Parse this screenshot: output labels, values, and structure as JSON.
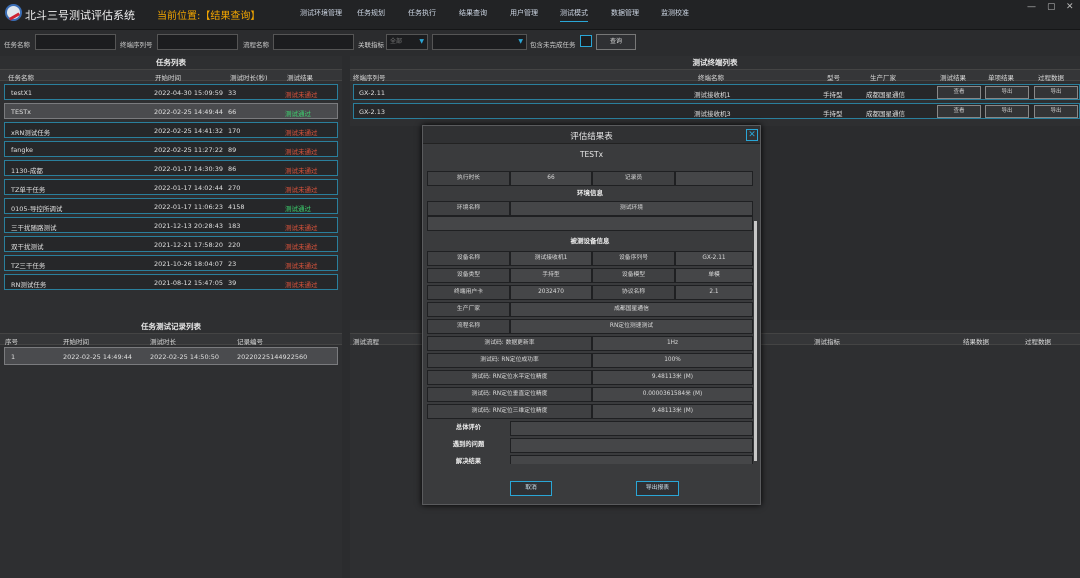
{
  "app": {
    "title": "北斗三号测试评估系统",
    "location": "当前位置:【结果查询】"
  },
  "nav": [
    {
      "label": "测试环境管理"
    },
    {
      "label": "任务规划"
    },
    {
      "label": "任务执行"
    },
    {
      "label": "结果查询"
    },
    {
      "label": "用户管理"
    },
    {
      "label": "测试模式"
    },
    {
      "label": "数据管理"
    },
    {
      "label": "监测校准"
    }
  ],
  "window": {
    "minimize": "—",
    "restore": "▢",
    "close": "✕"
  },
  "filters": {
    "task_name_label": "任务名称",
    "terminal_serial_label": "终端序列号",
    "process_name_label": "流程名称",
    "indicator_label": "关联指标",
    "indicator_value": "全部",
    "include_incomplete_label": "包含未完成任务",
    "query_button": "查询"
  },
  "task_list": {
    "title": "任务列表",
    "columns": [
      "任务名称",
      "开始时间",
      "测试时长(秒)",
      "测试结果"
    ],
    "rows": [
      {
        "name": "testX1",
        "start": "2022-04-30 15:09:59",
        "duration": "33",
        "result": "测试未通过",
        "status": "fail"
      },
      {
        "name": "TESTx",
        "start": "2022-02-25 14:49:44",
        "duration": "66",
        "result": "测试通过",
        "status": "pass"
      },
      {
        "name": "xRN测试任务",
        "start": "2022-02-25 14:41:32",
        "duration": "170",
        "result": "测试未通过",
        "status": "fail"
      },
      {
        "name": "fangke",
        "start": "2022-02-25 11:27:22",
        "duration": "89",
        "result": "测试未通过",
        "status": "fail"
      },
      {
        "name": "1130-成都",
        "start": "2022-01-17 14:30:39",
        "duration": "86",
        "result": "测试未通过",
        "status": "fail"
      },
      {
        "name": "TZ单干任务",
        "start": "2022-01-17 14:02:44",
        "duration": "270",
        "result": "测试未通过",
        "status": "fail"
      },
      {
        "name": "0105-导控所调试",
        "start": "2022-01-17 11:06:23",
        "duration": "4158",
        "result": "测试通过",
        "status": "pass"
      },
      {
        "name": "三干扰随路测试",
        "start": "2021-12-13 20:28:43",
        "duration": "183",
        "result": "测试未通过",
        "status": "fail"
      },
      {
        "name": "双干扰测试",
        "start": "2021-12-21 17:58:20",
        "duration": "220",
        "result": "测试未通过",
        "status": "fail"
      },
      {
        "name": "TZ三干任务",
        "start": "2021-10-26 18:04:07",
        "duration": "23",
        "result": "测试未通过",
        "status": "fail"
      },
      {
        "name": "RN测试任务",
        "start": "2021-08-12 15:47:05",
        "duration": "39",
        "result": "测试未通过",
        "status": "fail"
      }
    ]
  },
  "terminal_list": {
    "title": "测试终端列表",
    "columns": [
      "终端序列号",
      "终端名称",
      "型号",
      "生产厂家",
      "测试结果",
      "单项结果",
      "过程数据"
    ],
    "rows": [
      {
        "serial": "GX-2.11",
        "name": "测试接收机1",
        "model": "手持型",
        "maker": "成都国星通信",
        "btn1": "查看",
        "btn2": "导出",
        "btn3": "导出"
      },
      {
        "serial": "GX-2.13",
        "name": "测试接收机3",
        "model": "手持型",
        "maker": "成都国星通信",
        "btn1": "查看",
        "btn2": "导出",
        "btn3": "导出"
      }
    ]
  },
  "record_list": {
    "title": "任务测试记录列表",
    "columns": [
      "序号",
      "开始时间",
      "测试时长",
      "记录编号"
    ],
    "rows": [
      {
        "index": "1",
        "start": "2022-02-25 14:49:44",
        "duration": "2022-02-25 14:50:50",
        "record_no": "20220225144922560"
      }
    ]
  },
  "process_list": {
    "columns": [
      "测试流程",
      "测试指标",
      "结果数据",
      "过程数据"
    ]
  },
  "modal": {
    "title": "评估结果表",
    "subtitle": "TESTx",
    "exec_duration_label": "执行时长",
    "exec_duration_value": "66",
    "recorder_label": "记录员",
    "recorder_value": "",
    "env_section": "环境信息",
    "env_name_label": "环境名称",
    "env_name_value": "测试环境",
    "device_section": "被测设备信息",
    "device_name_label": "设备名称",
    "device_name_value": "测试接收机1",
    "device_serial_label": "设备序列号",
    "device_serial_value": "GX-2.11",
    "device_type_label": "设备类型",
    "device_type_value": "手持型",
    "device_model_label": "设备模型",
    "device_model_value": "单模",
    "user_card_label": "终端用户卡",
    "user_card_value": "2032470",
    "protocol_label": "协议名称",
    "protocol_value": "2.1",
    "maker_label": "生产厂家",
    "maker_value": "成都国星通信",
    "process_label": "流程名称",
    "process_value": "RN定位测速测试",
    "metrics": [
      {
        "label": "测试码: 数据更新率",
        "value": "1Hz"
      },
      {
        "label": "测试码: RN定位成功率",
        "value": "100%"
      },
      {
        "label": "测试码: RN定位水平定位精度",
        "value": "9.48113米 (M)"
      },
      {
        "label": "测试码: RN定位垂直定位精度",
        "value": "0.0000361584米 (M)"
      },
      {
        "label": "测试码: RN定位三维定位精度",
        "value": "9.48113米 (M)"
      }
    ],
    "overall_label": "总体评价",
    "issues_label": "遇到的问题",
    "solution_label": "解决结果",
    "cancel_button": "取消",
    "export_button": "导出报表",
    "close_icon": "✕"
  }
}
